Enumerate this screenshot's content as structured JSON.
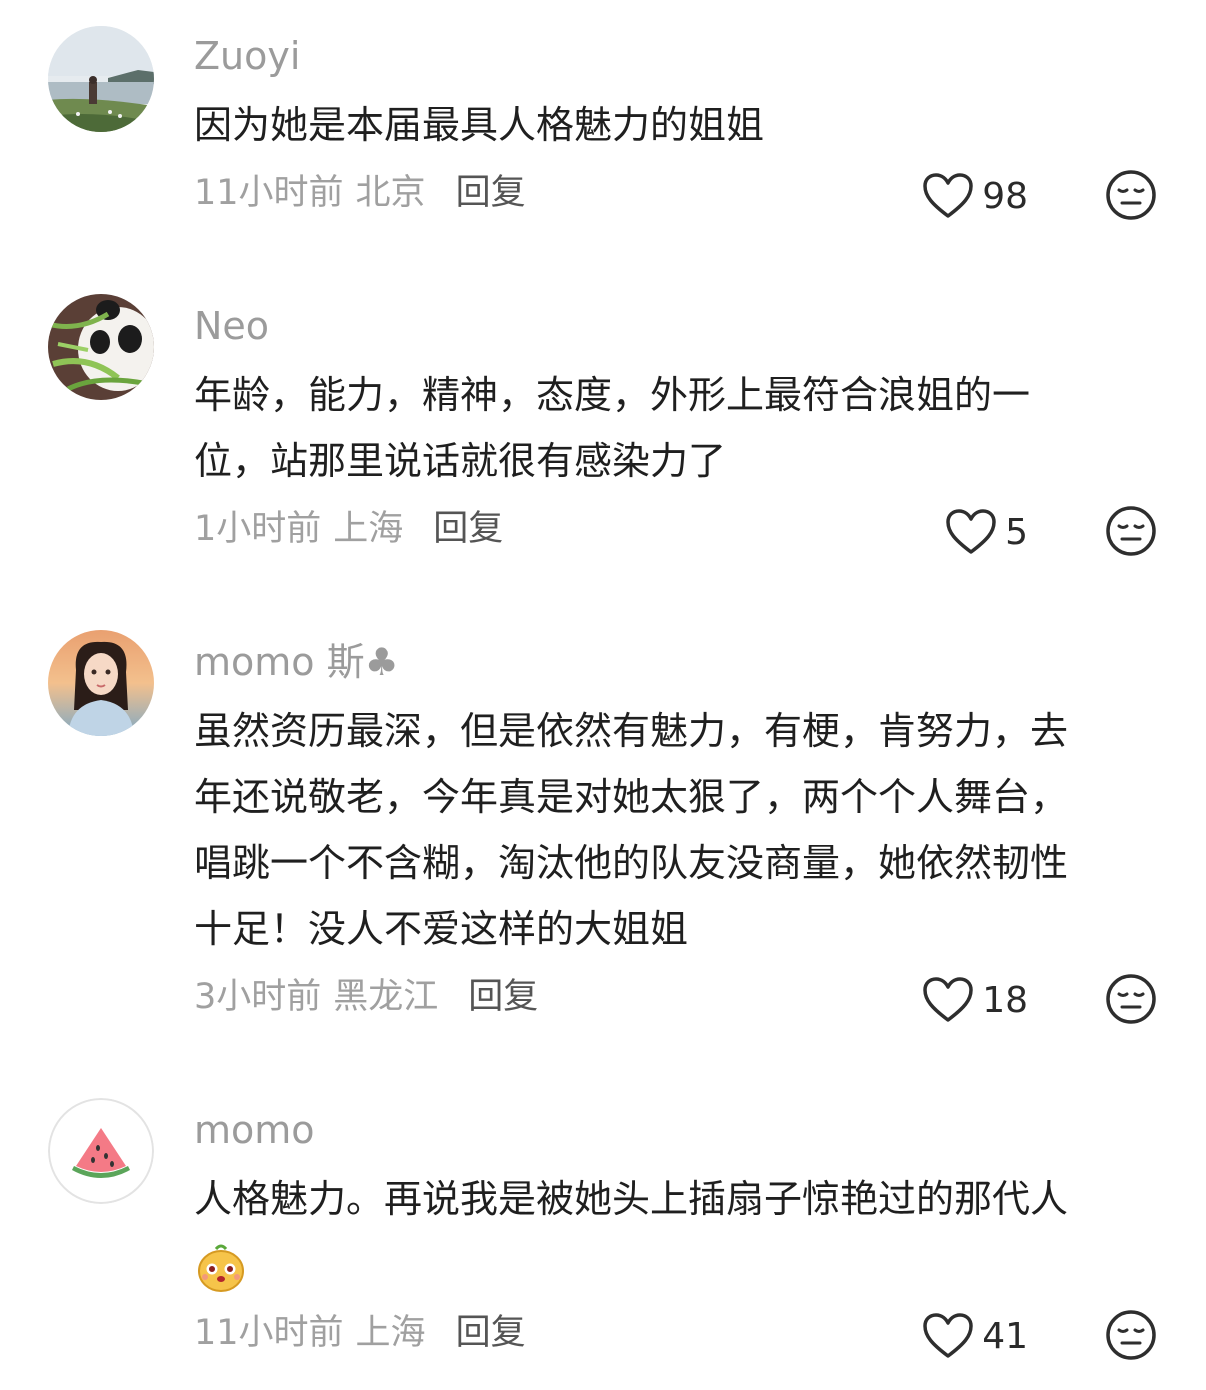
{
  "comments": [
    {
      "username": "Zuoyi",
      "lines": [
        "因为她是本届最具人格魅力的姐姐"
      ],
      "time": "11小时前",
      "location": "北京",
      "reply_label": "回复",
      "likes": "98",
      "avatar_icon": "seaside-photo-avatar"
    },
    {
      "username": "Neo",
      "lines": [
        "年龄，能力，精神，态度，外形上最符合浪姐的一",
        "位，站那里说话就很有感染力了"
      ],
      "time": "1小时前",
      "location": "上海",
      "reply_label": "回复",
      "likes": "5",
      "avatar_icon": "panda-bamboo-avatar"
    },
    {
      "username": "momo 斯♣",
      "lines": [
        "虽然资历最深，但是依然有魅力，有梗，肯努力，去",
        "年还说敬老，今年真是对她太狠了，两个个人舞台，",
        "唱跳一个不含糊，淘汰他的队友没商量，她依然韧性",
        "十足！没人不爱这样的大姐姐"
      ],
      "time": "3小时前",
      "location": "黑龙江",
      "reply_label": "回复",
      "likes": "18",
      "avatar_icon": "illustrated-girl-avatar"
    },
    {
      "username": "momo",
      "lines": [
        "人格魅力。再说我是被她头上插扇子惊艳过的那代人"
      ],
      "has_emoji": true,
      "emoji_icon": "cute-dog-emoji",
      "time": "11小时前",
      "location": "上海",
      "reply_label": "回复",
      "likes": "41",
      "avatar_icon": "watermelon-avatar"
    }
  ],
  "icons": {
    "like": "heart-outline-icon",
    "dislike": "meh-face-icon"
  },
  "colors": {
    "username": "#9b9b9b",
    "body": "#1f1f1f",
    "meta": "#a0a0a0",
    "reply": "#555555"
  }
}
